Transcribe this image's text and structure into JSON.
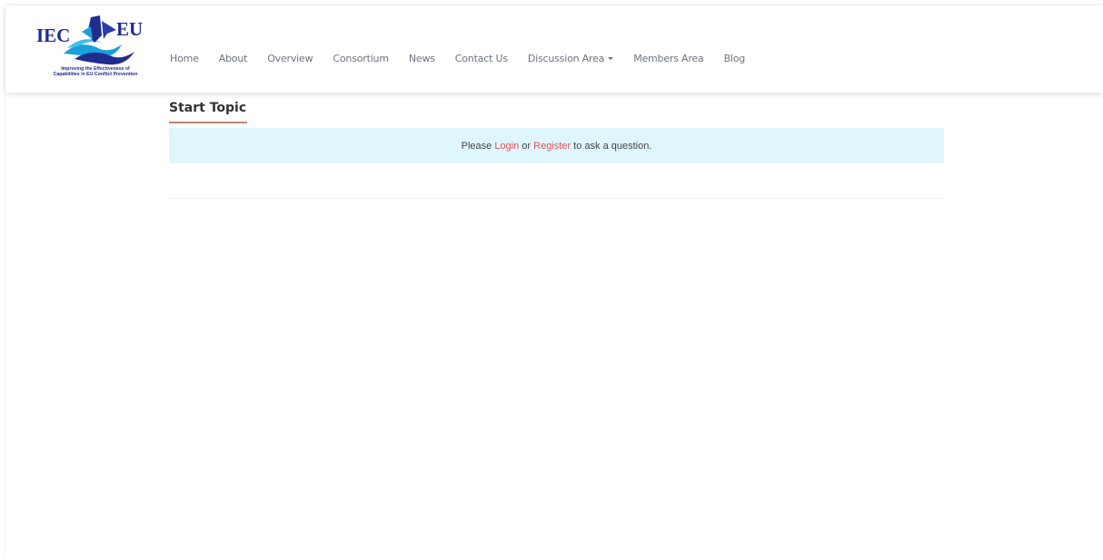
{
  "logo": {
    "left_text": "IEC",
    "right_text": "EU",
    "caption_line1": "Improving the Effectiveness of",
    "caption_line2": "Capabilities in EU Conflict Prevention"
  },
  "nav": {
    "items": [
      "Home",
      "About",
      "Overview",
      "Consortium",
      "News",
      "Contact Us",
      "Discussion Area",
      "Members Area",
      "Blog"
    ]
  },
  "main": {
    "title": "Start Topic",
    "alert": {
      "prefix": "Please ",
      "login": "Login",
      "middle": " or ",
      "register": "Register",
      "suffix": " to ask a question."
    }
  },
  "colors": {
    "alert_bg": "#dff6fd",
    "link": "#d9534f",
    "accent_underline": "#b9876e",
    "logo_blue": "#1f2d8f"
  },
  "icons": {
    "dropdown": "caret-down-icon"
  }
}
